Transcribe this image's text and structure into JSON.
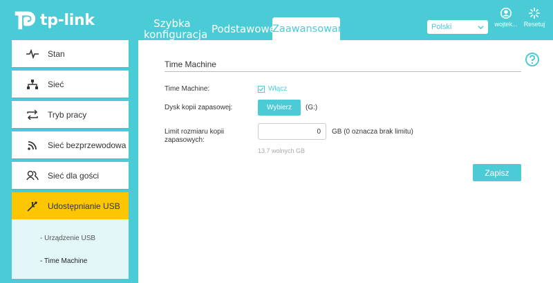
{
  "brand": {
    "name": "tp-link"
  },
  "tabs": {
    "quick": "Szybka konfiguracja",
    "basic": "Podstawowe",
    "advanced": "Zaawansowane"
  },
  "language": {
    "selected": "Polski"
  },
  "top_icons": {
    "user_label": "wojtek...",
    "reset_label": "Resetuj"
  },
  "sidebar": {
    "items": [
      {
        "label": "Stan",
        "icon": "activity-icon"
      },
      {
        "label": "Sieć",
        "icon": "network-icon"
      },
      {
        "label": "Tryb pracy",
        "icon": "swap-icon"
      },
      {
        "label": "Sieć bezprzewodowa",
        "icon": "wifi-icon"
      },
      {
        "label": "Sieć dla gości",
        "icon": "guests-icon"
      },
      {
        "label": "Udostępnianie USB",
        "icon": "usb-icon",
        "active": true
      }
    ],
    "subitems": [
      {
        "label": "- Urządzenie USB"
      },
      {
        "label": "- Time Machine",
        "current": true
      }
    ]
  },
  "main": {
    "title": "Time Machine",
    "fields": {
      "time_machine_label": "Time Machine:",
      "enable_label": "Włącz",
      "enable_checked": true,
      "backup_disk_label": "Dysk kopii zapasowej:",
      "choose_button": "Wybierz",
      "drive": "(G:)",
      "limit_label": "Limit rozmiaru kopii zapasowych:",
      "limit_value": "0",
      "limit_unit": "GB (0 oznacza brak limitu)",
      "free_space": "13.7 wolnych GB"
    },
    "save_button": "Zapisz"
  },
  "colors": {
    "accent": "#4acbd6",
    "active": "#fcc700",
    "submenu_bg": "#e3f7f9"
  }
}
